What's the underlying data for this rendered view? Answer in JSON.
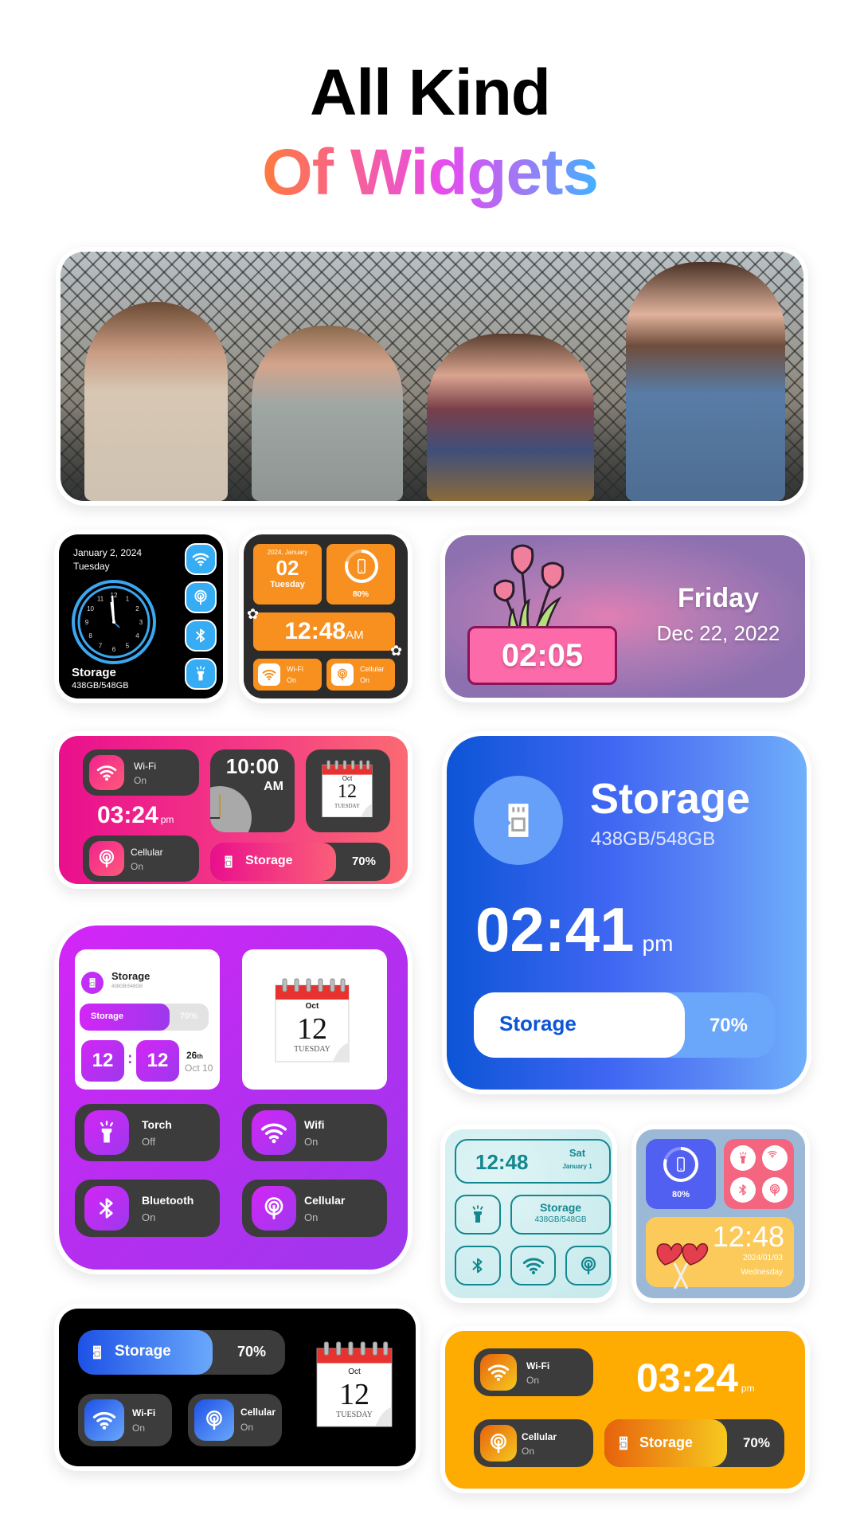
{
  "header": {
    "line1": "All Kind",
    "line2": "Of Widgets"
  },
  "photo_card": {
    "alt": "four women sitting on a bench in front of a chain-link fence"
  },
  "widget_black_clock": {
    "date": "January 2, 2024",
    "weekday": "Tuesday",
    "storage_label": "Storage",
    "storage_value": "438GB/548GB",
    "clock_numbers": [
      "12",
      "1",
      "2",
      "3",
      "4",
      "5",
      "6",
      "7",
      "8",
      "9",
      "10",
      "11"
    ],
    "toggles": [
      "wifi-icon",
      "cellular-icon",
      "bluetooth-icon",
      "torch-icon"
    ],
    "accent": "#3aa7f0"
  },
  "widget_orange_grid": {
    "date_header": "2024, January",
    "day": "02",
    "weekday": "Tuesday",
    "battery": "80%",
    "battery_fraction": 0.8,
    "time": "12:48",
    "ampm": "AM",
    "wifi_label": "Wi-Fi",
    "wifi_state": "On",
    "cellular_label": "Cellular",
    "cellular_state": "On",
    "accent": "#f7901e"
  },
  "widget_tulip": {
    "time": "02:05",
    "weekday": "Friday",
    "date": "Dec 22, 2022"
  },
  "widget_pink": {
    "wifi_label": "Wi-Fi",
    "wifi_state": "On",
    "time": "03:24",
    "ampm": "pm",
    "cellular_label": "Cellular",
    "cellular_state": "On",
    "clock_time": "10:00",
    "clock_ampm": "AM",
    "calendar_month": "Oct",
    "calendar_day": "12",
    "calendar_weekday": "TUESDAY",
    "storage_label": "Storage",
    "storage_percent": "70%",
    "storage_fraction": 0.7
  },
  "widget_blue_storage": {
    "title": "Storage",
    "value": "438GB/548GB",
    "time": "02:41",
    "ampm": "pm",
    "bar_label": "Storage",
    "bar_percent": "70%",
    "bar_fraction": 0.7
  },
  "widget_purple": {
    "storage_title": "Storage",
    "storage_value": "438GB/548GB",
    "bar_label": "Storage",
    "bar_percent": "70%",
    "bar_fraction": 0.7,
    "hour": "12",
    "minute": "12",
    "day_ordinal": "26",
    "day_suffix": "th",
    "date_short": "Oct 10",
    "calendar_month": "Oct",
    "calendar_day": "12",
    "calendar_weekday": "TUESDAY",
    "toggles": [
      {
        "label": "Torch",
        "state": "Off",
        "icon": "torch-icon"
      },
      {
        "label": "Wifi",
        "state": "On",
        "icon": "wifi-icon"
      },
      {
        "label": "Bluetooth",
        "state": "On",
        "icon": "bluetooth-icon"
      },
      {
        "label": "Cellular",
        "state": "On",
        "icon": "cellular-icon"
      }
    ]
  },
  "widget_teal": {
    "time": "12:48",
    "weekday": "Sat",
    "date": "January 1",
    "storage_label": "Storage",
    "storage_value": "438GB/548GB"
  },
  "widget_hearts": {
    "battery": "80%",
    "battery_fraction": 0.8,
    "time": "12:48",
    "date": "2024/01/03",
    "weekday": "Wednesday"
  },
  "widget_black_storage": {
    "storage_label": "Storage",
    "storage_percent": "70%",
    "storage_fraction": 0.65,
    "wifi_label": "Wi-Fi",
    "wifi_state": "On",
    "cellular_label": "Cellular",
    "cellular_state": "On",
    "calendar_month": "Oct",
    "calendar_day": "12",
    "calendar_weekday": "TUESDAY"
  },
  "widget_yellow": {
    "wifi_label": "Wi-Fi",
    "wifi_state": "On",
    "time": "03:24",
    "ampm": "pm",
    "cellular_label": "Cellular",
    "cellular_state": "On",
    "storage_label": "Storage",
    "storage_percent": "70%",
    "storage_fraction": 0.68
  }
}
